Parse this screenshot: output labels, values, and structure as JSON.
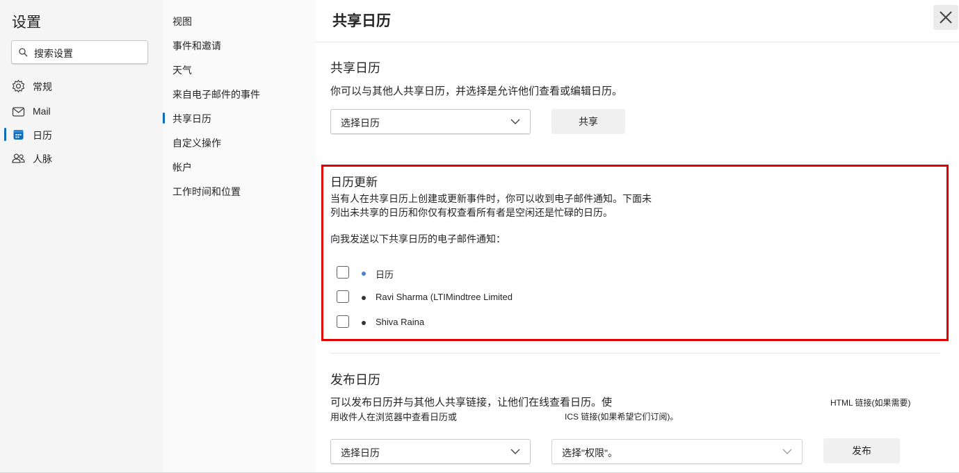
{
  "settings": {
    "title": "设置",
    "search_placeholder": "搜索设置",
    "nav": [
      {
        "label": "常规",
        "icon": "gear-icon"
      },
      {
        "label": "Mail",
        "icon": "mail-icon"
      },
      {
        "label": "日历",
        "icon": "calendar-icon",
        "selected": true
      },
      {
        "label": "人脉",
        "icon": "people-icon"
      }
    ]
  },
  "submenu": {
    "items": [
      "视图",
      "事件和邀请",
      "天气",
      "来自电子邮件的事件",
      "共享日历",
      "自定义操作",
      "帐户",
      "工作时间和位置"
    ],
    "selected": "共享日历"
  },
  "main": {
    "title": "共享日历",
    "close_icon": "close-icon",
    "share": {
      "heading": "共享日历",
      "description": "你可以与其他人共享日历，并选择是允许他们查看或编辑日历。",
      "select_value": "选择日历",
      "button_label": "共享"
    },
    "updates": {
      "heading": "日历更新",
      "description_line1": "当有人在共享日历上创建或更新事件时，你可以收到电子邮件通知。下面未",
      "description_line2": "列出未共享的日历和你仅有权查看所有者是空闲还是忙碌的日历。",
      "prompt": "向我发送以下共享日历的电子邮件通知：",
      "calendars": [
        {
          "name": "日历",
          "color": "#4a7fd6",
          "checked": false
        },
        {
          "name": "Ravi Sharma (LTIMindtree Limited",
          "color": "#333333",
          "checked": false
        },
        {
          "name": "Shiva Raina",
          "color": "#333333",
          "checked": false
        }
      ]
    },
    "publish": {
      "heading": "发布日历",
      "description_line1": "可以发布日历并与其他人共享链接，让他们在线查看日历。使",
      "description_line2": "用收件人在浏览器中查看日历或",
      "html_note": "HTML 链接(如果需要)",
      "ics_note": "ICS 链接(如果希望它们订阅)。",
      "calendar_select": "选择日历",
      "permission_select": "选择\"权限\"。",
      "button_label": "发布"
    }
  },
  "colors": {
    "accent": "#0f6cbd",
    "highlight_border": "#e00000"
  }
}
